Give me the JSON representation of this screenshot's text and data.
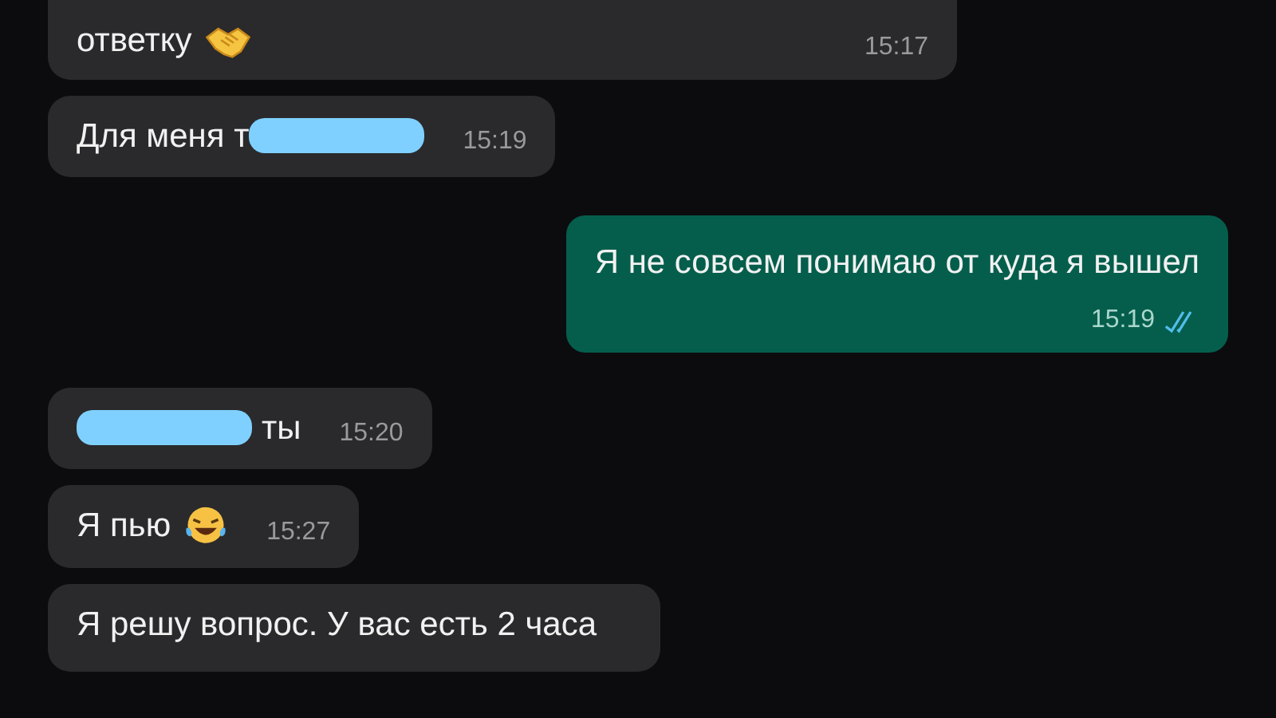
{
  "messages": [
    {
      "kind": "handshake",
      "outgoing": false,
      "text": "ответку",
      "time": "15:17"
    },
    {
      "kind": "redacted_after",
      "outgoing": false,
      "text": "Для меня т",
      "time": "15:19"
    },
    {
      "kind": "text",
      "outgoing": true,
      "text": "Я не совсем понимаю от куда я вышел",
      "time": "15:19",
      "read": true
    },
    {
      "kind": "redacted_before",
      "outgoing": false,
      "text": "ты",
      "time": "15:20"
    },
    {
      "kind": "laugh",
      "outgoing": false,
      "text": "Я пью",
      "time": "15:27"
    },
    {
      "kind": "text",
      "outgoing": false,
      "text": "Я решу вопрос. У вас есть 2 часа"
    }
  ]
}
